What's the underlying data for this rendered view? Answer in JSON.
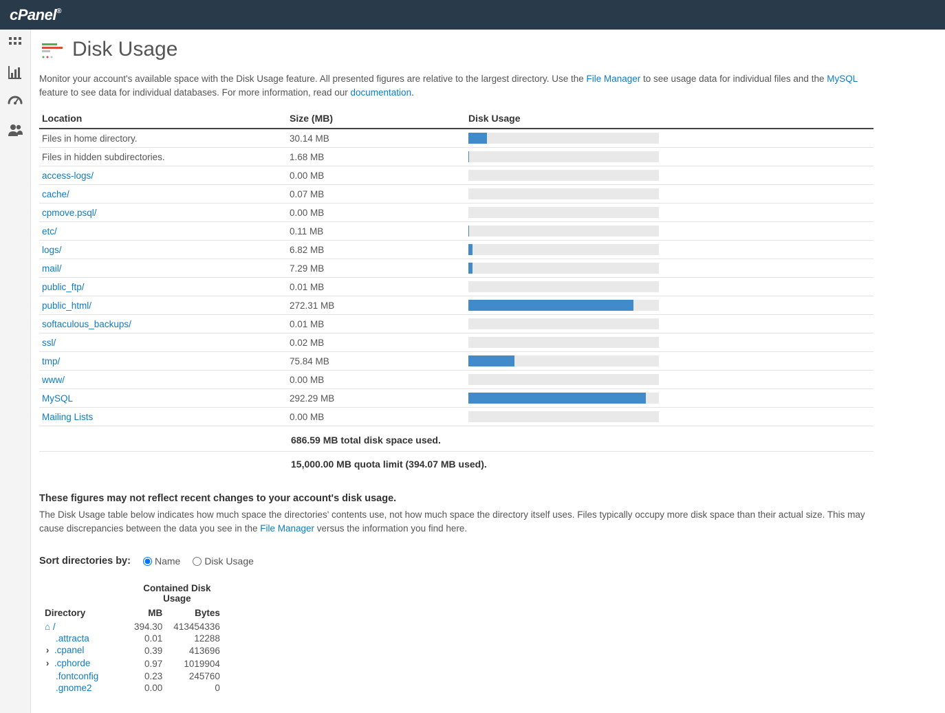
{
  "brand": "cPanel",
  "page": {
    "title": "Disk Usage"
  },
  "intro": {
    "a": "Monitor your account's available space with the Disk Usage feature. All presented figures are relative to the largest directory. Use the ",
    "link1": "File Manager",
    "b": " to see usage data for individual files and the ",
    "link2": "MySQL",
    "c": " feature to see data for individual databases. For more information, read our ",
    "link3": "documentation",
    "d": "."
  },
  "headers": {
    "loc": "Location",
    "size": "Size (MB)",
    "du": "Disk Usage"
  },
  "max_value": 292.29,
  "rows": [
    {
      "name": "Files in home directory.",
      "link": false,
      "size": "30.14 MB",
      "val": 30.14
    },
    {
      "name": "Files in hidden subdirectories.",
      "link": false,
      "size": "1.68 MB",
      "val": 1.68
    },
    {
      "name": "access-logs/",
      "link": true,
      "size": "0.00 MB",
      "val": 0.0
    },
    {
      "name": "cache/",
      "link": true,
      "size": "0.07 MB",
      "val": 0.07
    },
    {
      "name": "cpmove.psql/",
      "link": true,
      "size": "0.00 MB",
      "val": 0.0
    },
    {
      "name": "etc/",
      "link": true,
      "size": "0.11 MB",
      "val": 0.11
    },
    {
      "name": "logs/",
      "link": true,
      "size": "6.82 MB",
      "val": 6.82
    },
    {
      "name": "mail/",
      "link": true,
      "size": "7.29 MB",
      "val": 7.29
    },
    {
      "name": "public_ftp/",
      "link": true,
      "size": "0.01 MB",
      "val": 0.01
    },
    {
      "name": "public_html/",
      "link": true,
      "size": "272.31 MB",
      "val": 272.31
    },
    {
      "name": "softaculous_backups/",
      "link": true,
      "size": "0.01 MB",
      "val": 0.01
    },
    {
      "name": "ssl/",
      "link": true,
      "size": "0.02 MB",
      "val": 0.02
    },
    {
      "name": "tmp/",
      "link": true,
      "size": "75.84 MB",
      "val": 75.84
    },
    {
      "name": "www/",
      "link": true,
      "size": "0.00 MB",
      "val": 0.0
    },
    {
      "name": "MySQL",
      "link": true,
      "size": "292.29 MB",
      "val": 292.29
    },
    {
      "name": "Mailing Lists",
      "link": true,
      "size": "0.00 MB",
      "val": 0.0
    }
  ],
  "summary1": "686.59 MB total disk space used.",
  "summary2": "15,000.00 MB quota limit (394.07 MB used).",
  "note_strong": "These figures may not reflect recent changes to your account's disk usage.",
  "note_txt1": "The Disk Usage table below indicates how much space the directories' contents use, not how much space the directory itself uses. Files typically occupy more disk space than their actual size. This may cause discrepancies between the data you see in the ",
  "note_link": "File Manager",
  "note_txt2": " versus the information you find here.",
  "sort": {
    "label": "Sort directories by:",
    "opt1": "Name",
    "opt2": "Disk Usage"
  },
  "dir_head": {
    "dir": "Directory",
    "cdu": "Contained Disk Usage",
    "mb": "MB",
    "bytes": "Bytes"
  },
  "dir_rows": [
    {
      "name": "/",
      "icon": "home",
      "caret": false,
      "indent": 0,
      "mb": "394.30",
      "bytes": "413454336"
    },
    {
      "name": ".attracta",
      "icon": null,
      "caret": false,
      "indent": 1,
      "mb": "0.01",
      "bytes": "12288"
    },
    {
      "name": ".cpanel",
      "icon": null,
      "caret": true,
      "indent": 0,
      "mb": "0.39",
      "bytes": "413696"
    },
    {
      "name": ".cphorde",
      "icon": null,
      "caret": true,
      "indent": 0,
      "mb": "0.97",
      "bytes": "1019904"
    },
    {
      "name": ".fontconfig",
      "icon": null,
      "caret": false,
      "indent": 1,
      "mb": "0.23",
      "bytes": "245760"
    },
    {
      "name": ".gnome2",
      "icon": null,
      "caret": false,
      "indent": 1,
      "mb": "0.00",
      "bytes": "0"
    }
  ]
}
